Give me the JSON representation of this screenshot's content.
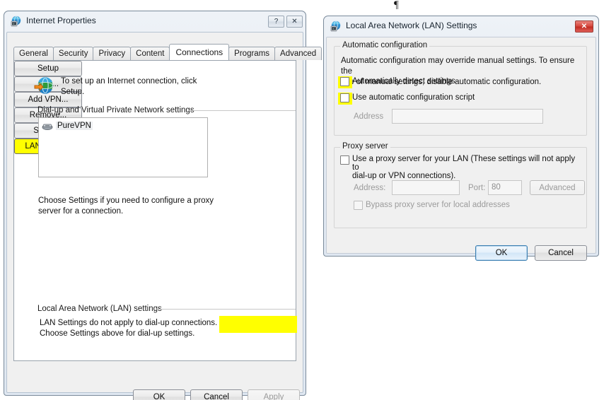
{
  "stray_mark": "¶",
  "internet_properties": {
    "title": "Internet Properties",
    "title_icon": "internet-properties-icon",
    "titlebar_buttons": [
      {
        "name": "help-button",
        "glyph": "?"
      },
      {
        "name": "close-button",
        "glyph": "✕"
      }
    ],
    "tabs": [
      {
        "label": "General",
        "active": false
      },
      {
        "label": "Security",
        "active": false
      },
      {
        "label": "Privacy",
        "active": false
      },
      {
        "label": "Content",
        "active": false
      },
      {
        "label": "Connections",
        "active": true
      },
      {
        "label": "Programs",
        "active": false
      },
      {
        "label": "Advanced",
        "active": false
      }
    ],
    "setup_row": {
      "icon": "globe-arrow-icon",
      "text_line1": "To set up an Internet connection, click",
      "text_line2": "Setup.",
      "button_label": "Setup"
    },
    "dialup_group": {
      "label": "Dial-up and Virtual Private Network settings",
      "list_items": [
        {
          "icon": "modem-icon",
          "label": "PureVPN",
          "selected": true
        }
      ],
      "buttons": [
        {
          "label": "Add...",
          "name": "add-button",
          "disabled": false
        },
        {
          "label": "Add VPN...",
          "name": "add-vpn-button",
          "disabled": false
        },
        {
          "label": "Remove...",
          "name": "remove-button",
          "disabled": false
        },
        {
          "label": "Settings",
          "name": "settings-button",
          "disabled": false
        }
      ],
      "hint_line1": "Choose Settings if you need to configure a proxy",
      "hint_line2": "server for a connection."
    },
    "lan_group": {
      "label": "Local Area Network (LAN) settings",
      "hint_line1": "LAN Settings do not apply to dial-up connections.",
      "hint_line2": "Choose Settings above for dial-up settings.",
      "button_label": "LAN settings",
      "button_highlighted": true,
      "highlight_color": "#ffff00"
    },
    "footer_buttons": [
      {
        "label": "OK",
        "name": "ok-button",
        "disabled": false
      },
      {
        "label": "Cancel",
        "name": "cancel-button",
        "disabled": false
      },
      {
        "label": "Apply",
        "name": "apply-button",
        "disabled": true
      }
    ]
  },
  "lan_settings": {
    "title": "Local Area Network (LAN) Settings",
    "title_icon": "lan-settings-icon",
    "close_button": {
      "name": "close-button",
      "glyph": "✕",
      "color": "#c22d24"
    },
    "auto_config": {
      "group_label": "Automatic configuration",
      "description_line1": "Automatic configuration may override manual settings.  To ensure the",
      "description_line2": "use of manual settings, disable automatic configuration.",
      "checkboxes": [
        {
          "label": "Automatically detect settings",
          "checked": false,
          "highlighted": true
        },
        {
          "label": "Use automatic configuration script",
          "checked": false,
          "highlighted": true
        }
      ],
      "address_label": "Address",
      "address_value": "",
      "address_disabled": true
    },
    "proxy_server": {
      "group_label": "Proxy server",
      "use_proxy_label_line1": "Use a proxy server for your LAN (These settings will not apply to",
      "use_proxy_label_line2": "dial-up or VPN connections).",
      "use_proxy_checked": false,
      "address_label": "Address:",
      "address_value": "",
      "port_label": "Port:",
      "port_value": "80",
      "advanced_button": "Advanced",
      "bypass_label": "Bypass proxy server for local addresses",
      "bypass_checked": false
    },
    "footer_buttons": [
      {
        "label": "OK",
        "name": "ok-button",
        "default": true
      },
      {
        "label": "Cancel",
        "name": "cancel-button",
        "default": false
      }
    ]
  }
}
